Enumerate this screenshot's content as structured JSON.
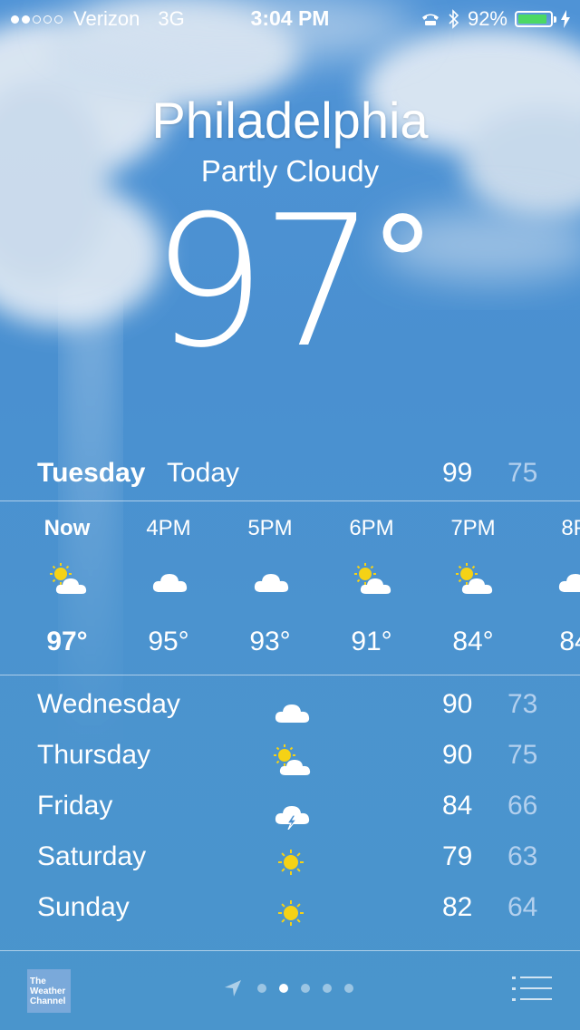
{
  "status_bar": {
    "signal_dots_on": 2,
    "signal_dots_total": 5,
    "carrier": "Verizon",
    "network": "3G",
    "time": "3:04 PM",
    "battery_percent": "92%",
    "battery_level": 0.92,
    "battery_color": "#4cd964"
  },
  "current": {
    "city": "Philadelphia",
    "condition": "Partly Cloudy",
    "temperature": "97",
    "degree": "°"
  },
  "today": {
    "day": "Tuesday",
    "label": "Today",
    "high": "99",
    "low": "75"
  },
  "hourly": [
    {
      "time": "Now",
      "icon": "partly-sunny-icon",
      "temp": "97°"
    },
    {
      "time": "4PM",
      "icon": "cloud-icon",
      "temp": "95°"
    },
    {
      "time": "5PM",
      "icon": "cloud-icon",
      "temp": "93°"
    },
    {
      "time": "6PM",
      "icon": "partly-sunny-icon",
      "temp": "91°"
    },
    {
      "time": "7PM",
      "icon": "partly-sunny-icon",
      "temp": "84°"
    },
    {
      "time": "8P",
      "icon": "cloud-icon",
      "temp": "84"
    }
  ],
  "daily": [
    {
      "day": "Wednesday",
      "icon": "cloud-icon",
      "high": "90",
      "low": "73"
    },
    {
      "day": "Thursday",
      "icon": "partly-sunny-icon",
      "high": "90",
      "low": "75"
    },
    {
      "day": "Friday",
      "icon": "thunderstorm-icon",
      "high": "84",
      "low": "66"
    },
    {
      "day": "Saturday",
      "icon": "sun-icon",
      "high": "79",
      "low": "63"
    },
    {
      "day": "Sunday",
      "icon": "sun-icon",
      "high": "82",
      "low": "64"
    }
  ],
  "footer": {
    "logo_text": "The Weather Channel",
    "page_count": 5,
    "active_page": 3
  },
  "colors": {
    "sun": "#f5d216",
    "low_temp": "#b3d0ee"
  }
}
